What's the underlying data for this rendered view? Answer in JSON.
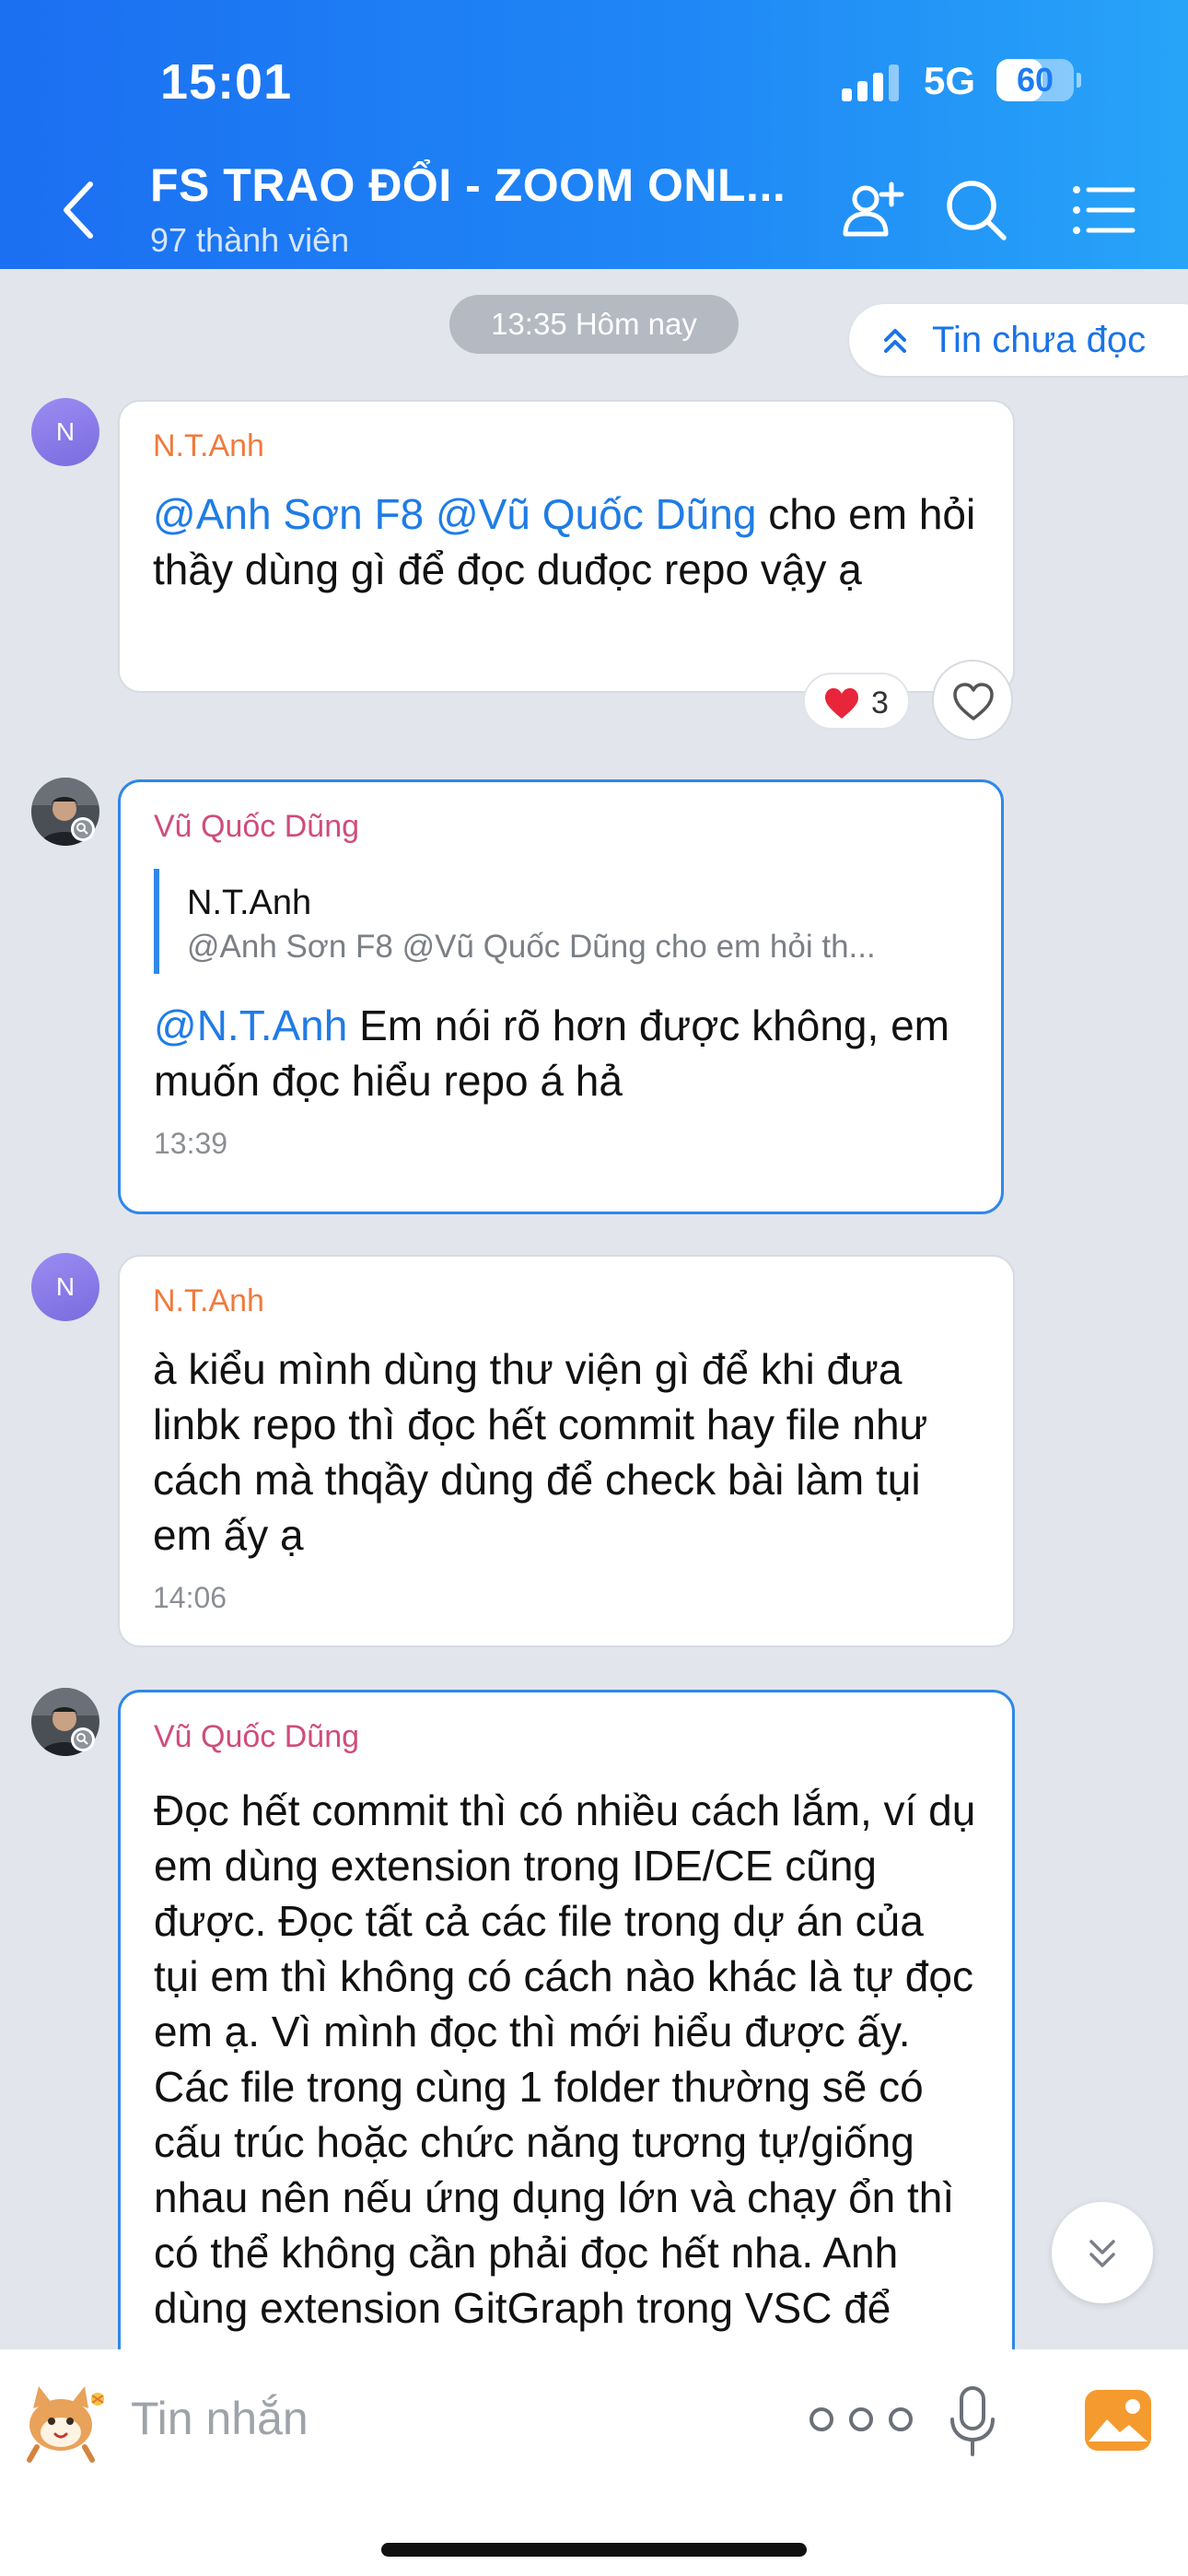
{
  "status_bar": {
    "time": "15:01",
    "network": "5G",
    "battery": "60",
    "battery_level": 0.6
  },
  "header": {
    "title": "FS TRAO ĐỔI - ZOOM ONL...",
    "subtitle": "97 thành viên"
  },
  "chat": {
    "date_label": "13:35 Hôm nay",
    "unread_label": "Tin chưa đọc",
    "messages": [
      {
        "avatar": "N",
        "sender": "N.T.Anh",
        "mention1": "@Anh Sơn F8",
        "mention2": "@Vũ Quốc Dũng",
        "text": " cho em hỏi thầy dùng gì để đọc duđọc repo vậy ạ",
        "reaction_count": "3"
      },
      {
        "sender": "Vũ Quốc Dũng",
        "quote_name": "N.T.Anh",
        "quote_text": "@Anh Sơn F8 @Vũ Quốc Dũng cho em hỏi th...",
        "mention": "@N.T.Anh",
        "text": " Em nói rõ hơn được không, em muốn đọc hiểu repo á hả",
        "time": "13:39"
      },
      {
        "avatar": "N",
        "sender": "N.T.Anh",
        "text": "à kiểu mình dùng thư viện gì để khi đưa linbk repo thì đọc hết commit hay file như cách mà thqầy dùng để check bài làm tụi em ấy ạ",
        "time": "14:06"
      },
      {
        "sender": "Vũ Quốc Dũng",
        "text": "Đọc hết commit thì có nhiều cách lắm, ví dụ em dùng extension trong IDE/CE cũng được. Đọc tất cả các file trong dự án của tụi em thì không có cách nào khác là tự đọc em ạ. Vì mình đọc thì mới hiểu được ấy. Các file trong cùng 1 folder thường sẽ có cấu trúc hoặc chức năng tương tự/giống nhau nên nếu ứng dụng lớn và chạy ổn thì có thể không cần phải đọc hết nha. Anh dùng extension GitGraph trong VSC để"
      }
    ]
  },
  "composer": {
    "placeholder": "Tin nhắn"
  },
  "colors": {
    "header_start": "#1b6ff1",
    "header_end": "#27a4f8",
    "mention": "#1f7ce6",
    "sender_orange": "#f07a3c",
    "sender_pink": "#d04c7c",
    "own_border": "#2f87ea"
  },
  "icons": [
    "back-chevron-icon",
    "add-member-icon",
    "search-icon",
    "menu-list-icon",
    "double-chevron-up-icon",
    "heart-icon",
    "double-chevron-down-icon",
    "sticker-icon",
    "more-dots-icon",
    "microphone-icon",
    "image-icon"
  ]
}
